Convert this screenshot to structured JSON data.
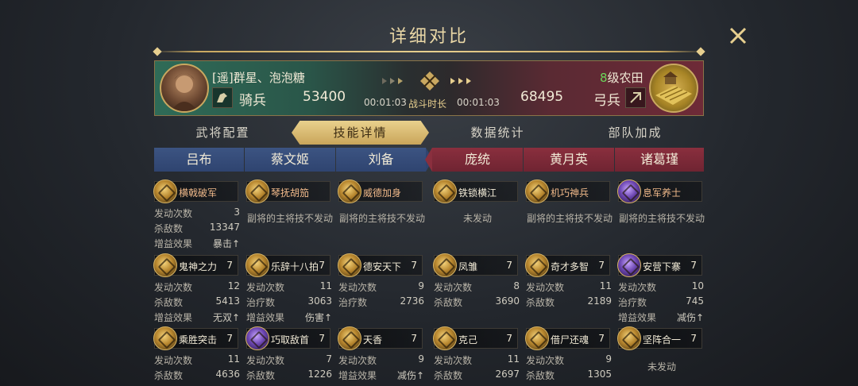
{
  "title": "详细对比",
  "header": {
    "left": {
      "name": "[遥]群星、泡泡糖",
      "unit_type": "骑兵",
      "troops": "53400",
      "time": "00:01:03"
    },
    "duration_label": "战斗时长",
    "right": {
      "level_num": "8",
      "level_suffix": "级农田",
      "unit_type": "弓兵",
      "troops": "68495",
      "time": "00:01:03"
    }
  },
  "tabs": [
    "武将配置",
    "技能详情",
    "数据统计",
    "部队加成"
  ],
  "active_tab": 1,
  "generals": [
    "吕布",
    "蔡文姬",
    "刘备",
    "庞统",
    "黄月英",
    "诸葛瑾"
  ],
  "columns": [
    {
      "skills": [
        {
          "name": "横戟破军",
          "level": "",
          "lines": [
            [
              "发动次数",
              "3"
            ],
            [
              "杀敌数",
              "13347"
            ],
            [
              "增益效果",
              "暴击↑"
            ]
          ]
        },
        {
          "name": "鬼神之力",
          "level": "7",
          "lines": [
            [
              "发动次数",
              "12"
            ],
            [
              "杀敌数",
              "5413"
            ],
            [
              "增益效果",
              "无双↑"
            ]
          ]
        },
        {
          "name": "乘胜突击",
          "level": "7",
          "lines": [
            [
              "发动次数",
              "11"
            ],
            [
              "杀敌数",
              "4636"
            ]
          ]
        }
      ]
    },
    {
      "skills": [
        {
          "name": "琴抚胡笳",
          "level": "",
          "note": "副将的主将技不发动"
        },
        {
          "name": "乐辞十八拍",
          "level": "7",
          "lines": [
            [
              "发动次数",
              "11"
            ],
            [
              "治疗数",
              "3063"
            ],
            [
              "增益效果",
              "伤害↑"
            ]
          ]
        },
        {
          "name": "巧取敌首",
          "level": "7",
          "lines": [
            [
              "发动次数",
              "7"
            ],
            [
              "杀敌数",
              "1226"
            ]
          ]
        }
      ]
    },
    {
      "skills": [
        {
          "name": "威德加身",
          "level": "",
          "note": "副将的主将技不发动"
        },
        {
          "name": "德安天下",
          "level": "7",
          "lines": [
            [
              "发动次数",
              "9"
            ],
            [
              "治疗数",
              "2736"
            ]
          ]
        },
        {
          "name": "天香",
          "level": "7",
          "lines": [
            [
              "发动次数",
              "9"
            ],
            [
              "增益效果",
              "减伤↑"
            ]
          ]
        }
      ]
    },
    {
      "skills": [
        {
          "name": "铁锁横江",
          "level": "",
          "note": "未发动"
        },
        {
          "name": "凤雏",
          "level": "7",
          "lines": [
            [
              "发动次数",
              "8"
            ],
            [
              "杀敌数",
              "3690"
            ]
          ]
        },
        {
          "name": "克己",
          "level": "7",
          "lines": [
            [
              "发动次数",
              "11"
            ],
            [
              "杀敌数",
              "2697"
            ]
          ]
        }
      ]
    },
    {
      "skills": [
        {
          "name": "机巧神兵",
          "level": "",
          "note": "副将的主将技不发动"
        },
        {
          "name": "奇才多智",
          "level": "7",
          "lines": [
            [
              "发动次数",
              "11"
            ],
            [
              "杀敌数",
              "2189"
            ]
          ]
        },
        {
          "name": "借尸还魂",
          "level": "7",
          "lines": [
            [
              "发动次数",
              "9"
            ],
            [
              "杀敌数",
              "1305"
            ]
          ]
        }
      ]
    },
    {
      "skills": [
        {
          "name": "息军养士",
          "level": "",
          "note": "副将的主将技不发动"
        },
        {
          "name": "安营下寨",
          "level": "7",
          "lines": [
            [
              "发动次数",
              "10"
            ],
            [
              "治疗数",
              "745"
            ],
            [
              "增益效果",
              "减伤↑"
            ]
          ]
        },
        {
          "name": "坚阵合一",
          "level": "7",
          "note": "未发动"
        }
      ]
    }
  ]
}
